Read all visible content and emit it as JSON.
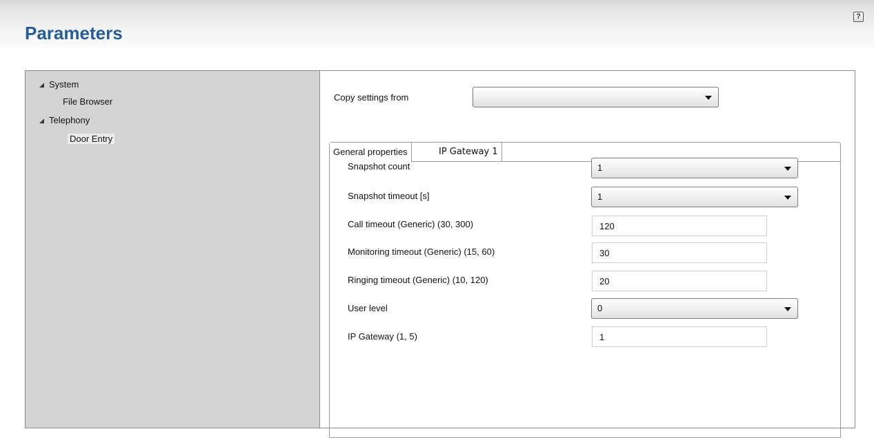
{
  "page": {
    "title": "Parameters",
    "help_icon": "?"
  },
  "tree": {
    "nodes": [
      {
        "label": "System",
        "expanded": true,
        "children": [
          {
            "label": "File Browser",
            "selected": false
          }
        ]
      },
      {
        "label": "Telephony",
        "expanded": true,
        "children": [
          {
            "label": "Door Entry",
            "selected": true
          }
        ]
      }
    ]
  },
  "copy_settings": {
    "label": "Copy settings from",
    "value": ""
  },
  "tabs": [
    {
      "label": "General properties",
      "active": true
    },
    {
      "label": "IP Gateway 1",
      "active": false
    }
  ],
  "fields": [
    {
      "label": "Snapshot count",
      "type": "select",
      "value": "1"
    },
    {
      "label": "Snapshot timeout [s]",
      "type": "select",
      "value": "1"
    },
    {
      "label": "Call timeout (Generic) (30, 300)",
      "type": "text",
      "value": "120"
    },
    {
      "label": "Monitoring timeout (Generic) (15, 60)",
      "type": "text",
      "value": "30"
    },
    {
      "label": "Ringing timeout (Generic) (10, 120)",
      "type": "text",
      "value": "20"
    },
    {
      "label": "User level",
      "type": "select",
      "value": "0"
    },
    {
      "label": "IP Gateway (1, 5)",
      "type": "text",
      "value": "1"
    }
  ]
}
